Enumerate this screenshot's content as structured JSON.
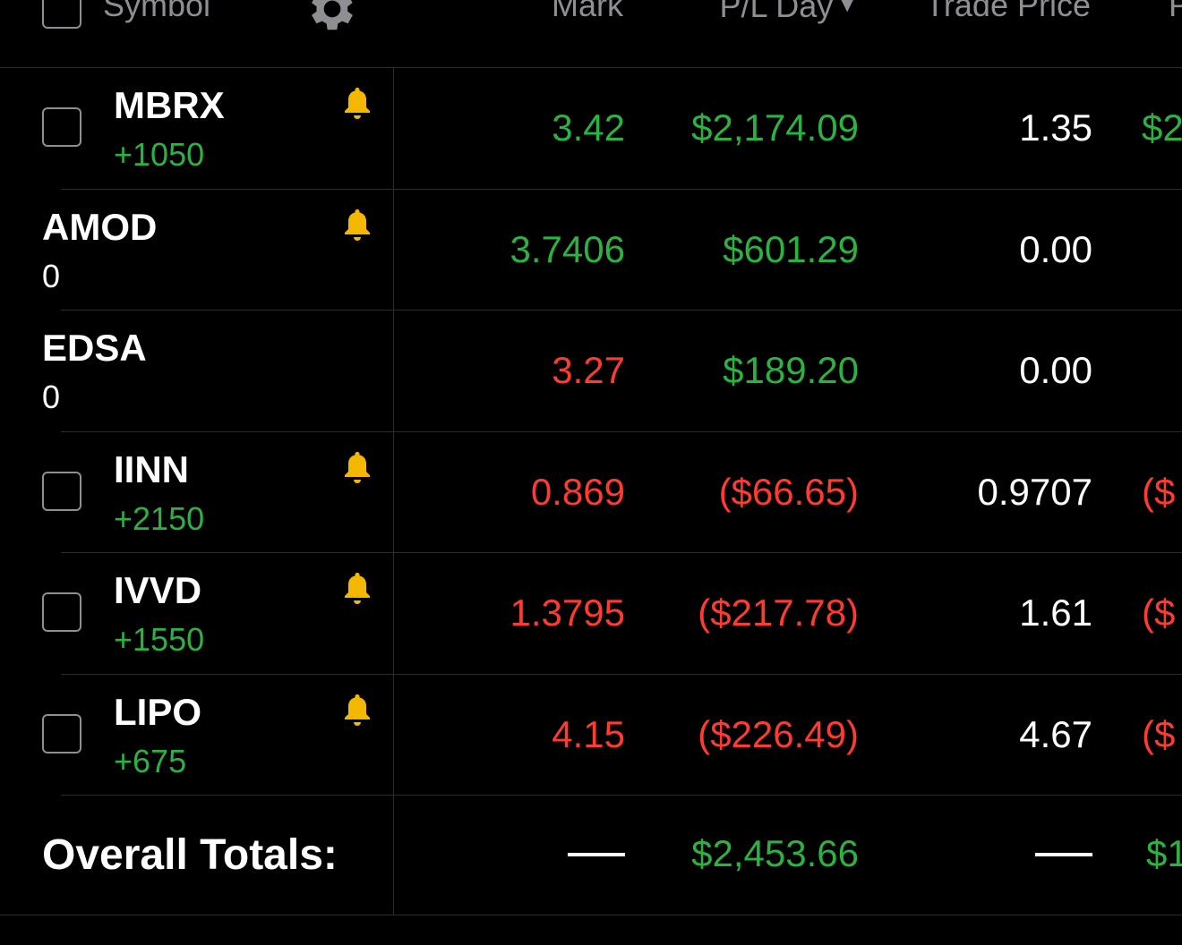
{
  "colors": {
    "gain": "#2ab340",
    "loss": "#ff3b30",
    "neutral": "#ffffff",
    "bell": "#f5b800"
  },
  "header": {
    "symbol_label": "Symbol",
    "mark_label": "Mark",
    "pl_day_label": "P/L Day",
    "sort_indicator": "▼",
    "trade_price_label": "Trade Price",
    "next_label": "P"
  },
  "rows": [
    {
      "symbol": "MBRX",
      "qty": "+1050",
      "qty_color": "gain",
      "has_checkbox": true,
      "has_alert": true,
      "mark": "3.42",
      "mark_color": "gain",
      "pl_day": "$2,174.09",
      "pl_color": "gain",
      "trade_price": "1.35",
      "next": "$2",
      "next_color": "gain"
    },
    {
      "symbol": "AMOD",
      "qty": "0",
      "qty_color": "neutral",
      "has_checkbox": false,
      "has_alert": true,
      "mark": "3.7406",
      "mark_color": "gain",
      "pl_day": "$601.29",
      "pl_color": "gain",
      "trade_price": "0.00",
      "next": "",
      "next_color": "gain"
    },
    {
      "symbol": "EDSA",
      "qty": "0",
      "qty_color": "neutral",
      "has_checkbox": false,
      "has_alert": false,
      "mark": "3.27",
      "mark_color": "loss",
      "pl_day": "$189.20",
      "pl_color": "gain",
      "trade_price": "0.00",
      "next": "",
      "next_color": "gain"
    },
    {
      "symbol": "IINN",
      "qty": "+2150",
      "qty_color": "gain",
      "has_checkbox": true,
      "has_alert": true,
      "mark": "0.869",
      "mark_color": "loss",
      "pl_day": "($66.65)",
      "pl_color": "loss",
      "trade_price": "0.9707",
      "next": "($",
      "next_color": "loss"
    },
    {
      "symbol": "IVVD",
      "qty": "+1550",
      "qty_color": "gain",
      "has_checkbox": true,
      "has_alert": true,
      "mark": "1.3795",
      "mark_color": "loss",
      "pl_day": "($217.78)",
      "pl_color": "loss",
      "trade_price": "1.61",
      "next": "($",
      "next_color": "loss"
    },
    {
      "symbol": "LIPO",
      "qty": "+675",
      "qty_color": "gain",
      "has_checkbox": true,
      "has_alert": true,
      "mark": "4.15",
      "mark_color": "loss",
      "pl_day": "($226.49)",
      "pl_color": "loss",
      "trade_price": "4.67",
      "next": "($",
      "next_color": "loss"
    }
  ],
  "totals": {
    "label": "Overall Totals:",
    "mark": "—",
    "pl_day": "$2,453.66",
    "trade_price": "—",
    "next": "$1"
  }
}
